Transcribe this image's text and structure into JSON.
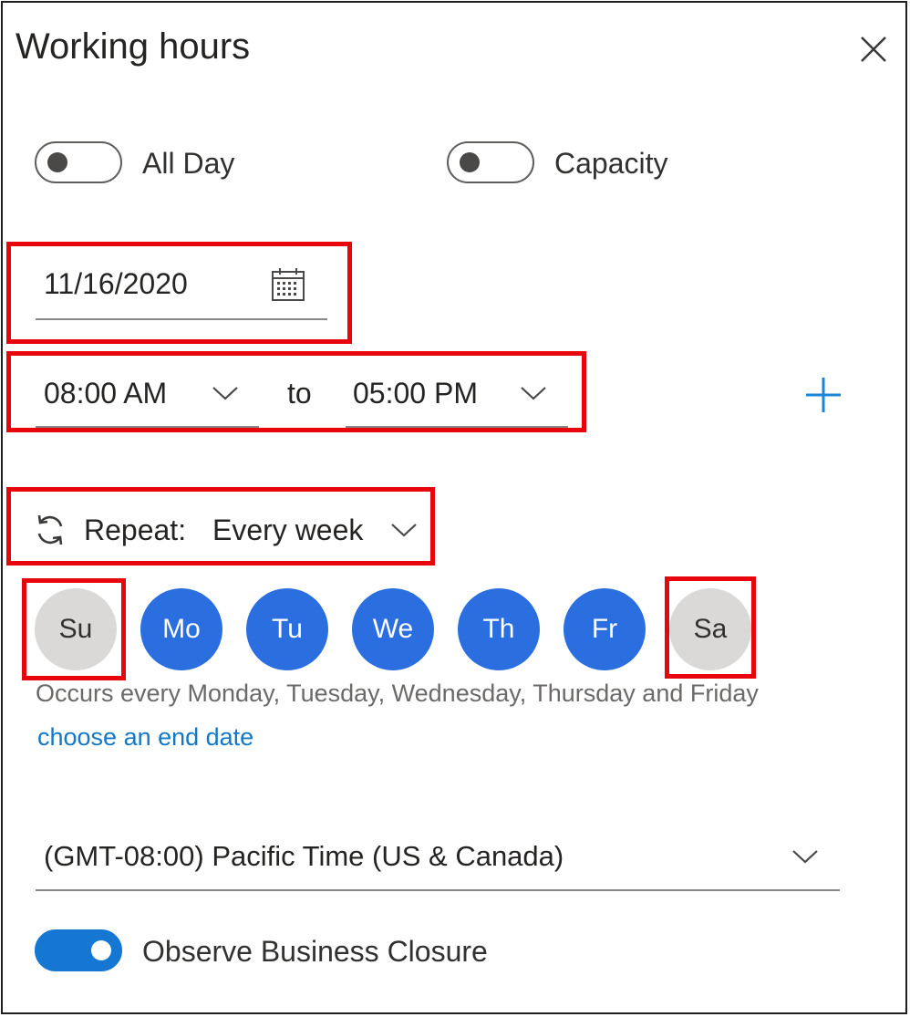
{
  "panel": {
    "title": "Working hours",
    "close_icon": "close-icon"
  },
  "toggles": {
    "all_day": {
      "label": "All Day",
      "on": false
    },
    "capacity": {
      "label": "Capacity",
      "on": false
    },
    "observe_business_closure": {
      "label": "Observe Business Closure",
      "on": true
    }
  },
  "date_field": {
    "value": "11/16/2020",
    "icon": "calendar-icon"
  },
  "time_range": {
    "start": "08:00 AM",
    "separator": "to",
    "end": "05:00 PM",
    "add_icon": "plus-icon"
  },
  "repeat": {
    "icon": "refresh-icon",
    "label": "Repeat:",
    "value": "Every week"
  },
  "days": [
    {
      "label": "Su",
      "selected": false
    },
    {
      "label": "Mo",
      "selected": true
    },
    {
      "label": "Tu",
      "selected": true
    },
    {
      "label": "We",
      "selected": true
    },
    {
      "label": "Th",
      "selected": true
    },
    {
      "label": "Fr",
      "selected": true
    },
    {
      "label": "Sa",
      "selected": false
    }
  ],
  "recurrence": {
    "summary": "Occurs every Monday, Tuesday, Wednesday, Thursday and Friday",
    "end_date_link": "choose an end date"
  },
  "timezone": {
    "value": "(GMT-08:00) Pacific Time (US & Canada)"
  },
  "colors": {
    "accent_blue": "#2b6ee0",
    "toggle_on": "#1577d2",
    "link": "#1478c6",
    "highlight_red": "#e8060d",
    "day_off": "#dad9d8"
  }
}
